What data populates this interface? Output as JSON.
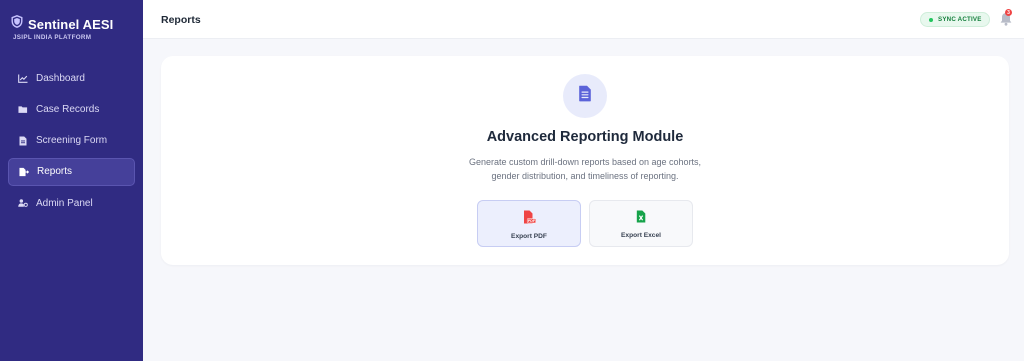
{
  "brand": {
    "name": "Sentinel AESI",
    "subtitle": "JSIPL INDIA PLATFORM",
    "icon": "shield-icon"
  },
  "sidebar": {
    "items": [
      {
        "label": "Dashboard",
        "icon": "chart-line-icon",
        "active": false
      },
      {
        "label": "Case Records",
        "icon": "folder-icon",
        "active": false
      },
      {
        "label": "Screening Form",
        "icon": "document-icon",
        "active": false
      },
      {
        "label": "Reports",
        "icon": "file-export-icon",
        "active": true
      },
      {
        "label": "Admin Panel",
        "icon": "user-gear-icon",
        "active": false
      }
    ]
  },
  "header": {
    "title": "Reports",
    "sync_status": "SYNC ACTIVE",
    "notifications_count": "3"
  },
  "main": {
    "module_title": "Advanced Reporting Module",
    "description_line1": "Generate custom drill-down reports based on age cohorts,",
    "description_line2": "gender distribution, and timeliness of reporting.",
    "export_pdf_label": "Export PDF",
    "export_excel_label": "Export Excel",
    "pdf_icon_text": "PDF"
  },
  "colors": {
    "sidebar_bg": "#302b82",
    "accent": "#5b63d9",
    "sync_green": "#22c55e",
    "pdf_red": "#ef4444",
    "excel_green": "#16a34a"
  }
}
